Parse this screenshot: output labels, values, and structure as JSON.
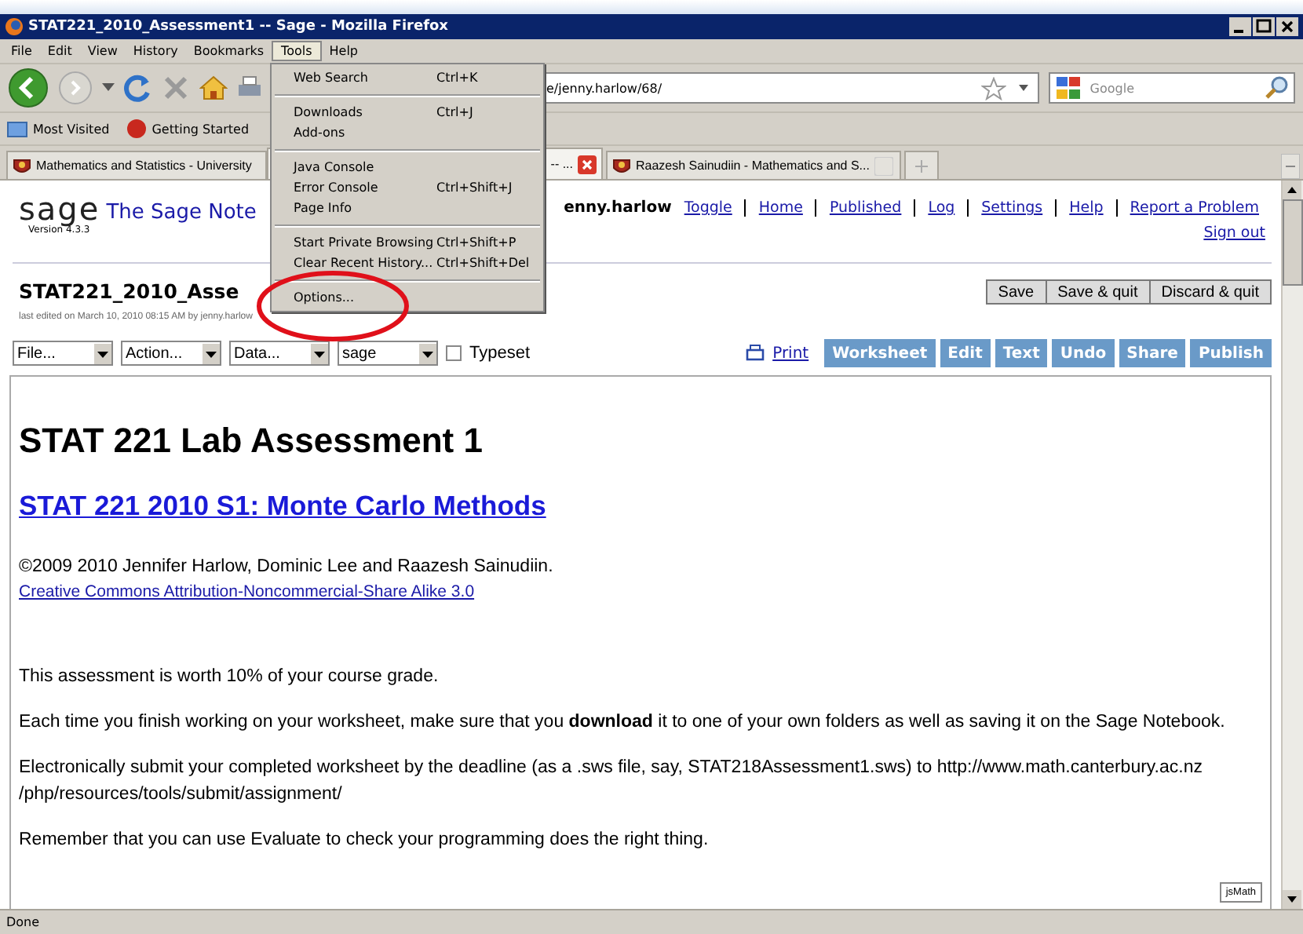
{
  "window": {
    "title": "STAT221_2010_Assessment1 -- Sage - Mozilla Firefox"
  },
  "menu_bar": [
    {
      "label": "File",
      "selected": false
    },
    {
      "label": "Edit",
      "selected": false
    },
    {
      "label": "View",
      "selected": false
    },
    {
      "label": "History",
      "selected": false
    },
    {
      "label": "Bookmarks",
      "selected": false
    },
    {
      "label": "Tools",
      "selected": true
    },
    {
      "label": "Help",
      "selected": false
    }
  ],
  "address_bar": {
    "value": "e/jenny.harlow/68/"
  },
  "search": {
    "placeholder": "Google"
  },
  "bookmarks": [
    {
      "label": "Most Visited",
      "kind": "folder"
    },
    {
      "label": "Getting Started",
      "kind": "page"
    }
  ],
  "tabs": [
    {
      "label": "Mathematics and Statistics - University",
      "selected": false
    },
    {
      "label": "-- ...",
      "selected": true
    },
    {
      "label": "Raazesh Sainudiin - Mathematics and S...",
      "selected": false
    }
  ],
  "tools_menu": [
    {
      "kind": "item",
      "label": "Web Search",
      "shortcut": "Ctrl+K"
    },
    {
      "kind": "separator"
    },
    {
      "kind": "item",
      "label": "Downloads",
      "shortcut": "Ctrl+J"
    },
    {
      "kind": "item",
      "label": "Add-ons"
    },
    {
      "kind": "separator"
    },
    {
      "kind": "item",
      "label": "Java Console"
    },
    {
      "kind": "item",
      "label": "Error Console",
      "shortcut": "Ctrl+Shift+J"
    },
    {
      "kind": "item",
      "label": "Page Info"
    },
    {
      "kind": "separator"
    },
    {
      "kind": "item",
      "label": "Start Private Browsing",
      "shortcut": "Ctrl+Shift+P"
    },
    {
      "kind": "item",
      "label": "Clear Recent History...",
      "shortcut": "Ctrl+Shift+Del"
    },
    {
      "kind": "separator"
    },
    {
      "kind": "item",
      "label": "Options..."
    }
  ],
  "sage_header": {
    "logo": "sage",
    "version": "Version 4.3.3",
    "title": "The Sage Note",
    "user": "enny.harlow",
    "links": [
      "Toggle",
      "Home",
      "Published",
      "Log",
      "Settings",
      "Help",
      "Report a Problem"
    ],
    "sign_out": "Sign out"
  },
  "worksheet": {
    "title": "STAT221_2010_Asse",
    "last_edited": "last edited on March 10, 2010 08:15 AM by jenny.harlow",
    "actions": [
      "Save",
      "Save & quit",
      "Discard & quit"
    ],
    "selects": [
      "File...",
      "Action...",
      "Data...",
      "sage"
    ],
    "typeset": {
      "label": "Typeset",
      "checked": false
    },
    "print": "Print",
    "view_buttons": [
      "Worksheet",
      "Edit",
      "Text",
      "Undo",
      "Share",
      "Publish"
    ]
  },
  "content": {
    "heading": "STAT 221 Lab Assessment 1",
    "subheading": "STAT 221 2010 S1: Monte Carlo Methods",
    "copyright": "©2009 2010 Jennifer Harlow, Dominic Lee and Raazesh Sainudiin.",
    "license": "Creative Commons Attribution-Noncommercial-Share Alike 3.0",
    "paragraphs": [
      "This assessment is worth 10% of your course grade.",
      "Each time you finish working on your worksheet, make sure that you **download** it to one of your own folders as well as saving it on the Sage Notebook.",
      "Electronically submit your completed worksheet by the deadline (as a .sws file, say, STAT218Assessment1.sws) to http://www.math.canterbury.ac.nz /php/resources/tools/submit/assignment/",
      "Remember that you can use Evaluate to check your programming does the right thing."
    ],
    "jsmath": "jsMath"
  },
  "status_bar": {
    "text": "Done"
  }
}
